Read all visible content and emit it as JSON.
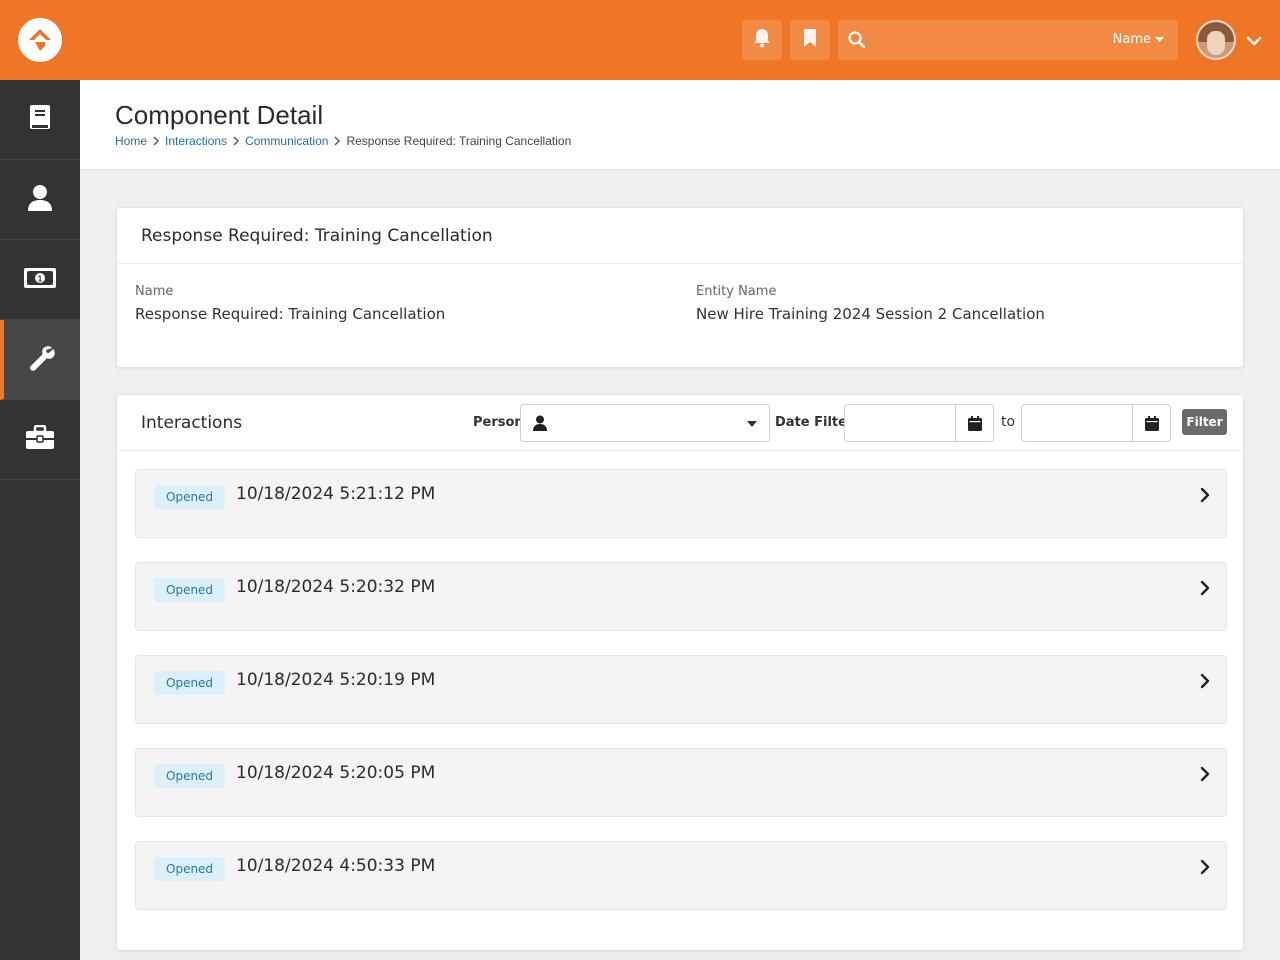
{
  "topbar": {
    "search_name_label": "Name",
    "accent_color": "#ee7625"
  },
  "sidebar": {
    "items": [
      {
        "icon": "book-icon"
      },
      {
        "icon": "person-icon"
      },
      {
        "icon": "money-icon"
      },
      {
        "icon": "wrench-icon",
        "active": true
      },
      {
        "icon": "briefcase-icon"
      }
    ]
  },
  "page": {
    "title": "Component Detail",
    "breadcrumb": [
      "Home",
      "Interactions",
      "Communication",
      "Response Required: Training Cancellation"
    ]
  },
  "detail": {
    "heading": "Response Required: Training Cancellation",
    "name_label": "Name",
    "name_value": "Response Required: Training Cancellation",
    "entity_label": "Entity Name",
    "entity_value": "New Hire Training 2024 Session 2 Cancellation"
  },
  "interactions": {
    "title": "Interactions",
    "person_label": "Person",
    "date_filter_label": "Date Filter",
    "to_label": "to",
    "filter_button": "Filter",
    "rows": [
      {
        "status": "Opened",
        "datetime": "10/18/2024 5:21:12 PM"
      },
      {
        "status": "Opened",
        "datetime": "10/18/2024 5:20:32 PM"
      },
      {
        "status": "Opened",
        "datetime": "10/18/2024 5:20:19 PM"
      },
      {
        "status": "Opened",
        "datetime": "10/18/2024 5:20:05 PM"
      },
      {
        "status": "Opened",
        "datetime": "10/18/2024 4:50:33 PM"
      }
    ]
  }
}
